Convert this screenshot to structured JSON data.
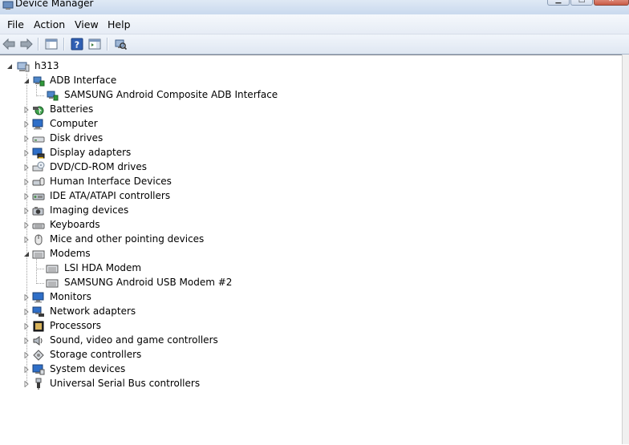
{
  "window": {
    "title": "Device Manager"
  },
  "menubar": {
    "items": [
      "File",
      "Action",
      "View",
      "Help"
    ]
  },
  "toolbar": {
    "buttons": [
      "back-icon",
      "forward-icon",
      "show-hide-console-tree-icon",
      "help-icon",
      "show-action-pane-icon",
      "scan-hardware-icon"
    ]
  },
  "tree": {
    "root": "h313",
    "items": [
      {
        "label": "ADB Interface",
        "expanded": true,
        "icon": "adb-interface-icon"
      },
      {
        "label": "SAMSUNG Android Composite ADB Interface",
        "icon": "adb-device-icon"
      },
      {
        "label": "Batteries",
        "icon": "battery-icon"
      },
      {
        "label": "Computer",
        "icon": "computer-icon"
      },
      {
        "label": "Disk drives",
        "icon": "disk-drive-icon"
      },
      {
        "label": "Display adapters",
        "icon": "display-adapter-icon"
      },
      {
        "label": "DVD/CD-ROM drives",
        "icon": "dvd-drive-icon"
      },
      {
        "label": "Human Interface Devices",
        "icon": "hid-icon"
      },
      {
        "label": "IDE ATA/ATAPI controllers",
        "icon": "ide-controller-icon"
      },
      {
        "label": "Imaging devices",
        "icon": "camera-icon"
      },
      {
        "label": "Keyboards",
        "icon": "keyboard-icon"
      },
      {
        "label": "Mice and other pointing devices",
        "icon": "mouse-icon"
      },
      {
        "label": "Modems",
        "expanded": true,
        "icon": "modem-icon"
      },
      {
        "label": "LSI HDA Modem",
        "icon": "modem-device-icon"
      },
      {
        "label": "SAMSUNG Android USB Modem #2",
        "icon": "modem-device-icon"
      },
      {
        "label": "Monitors",
        "icon": "monitor-icon"
      },
      {
        "label": "Network adapters",
        "icon": "network-adapter-icon"
      },
      {
        "label": "Processors",
        "icon": "processor-icon"
      },
      {
        "label": "Sound, video and game controllers",
        "icon": "speaker-icon"
      },
      {
        "label": "Storage controllers",
        "icon": "storage-controller-icon"
      },
      {
        "label": "System devices",
        "icon": "system-device-icon"
      },
      {
        "label": "Universal Serial Bus controllers",
        "icon": "usb-icon"
      }
    ]
  }
}
